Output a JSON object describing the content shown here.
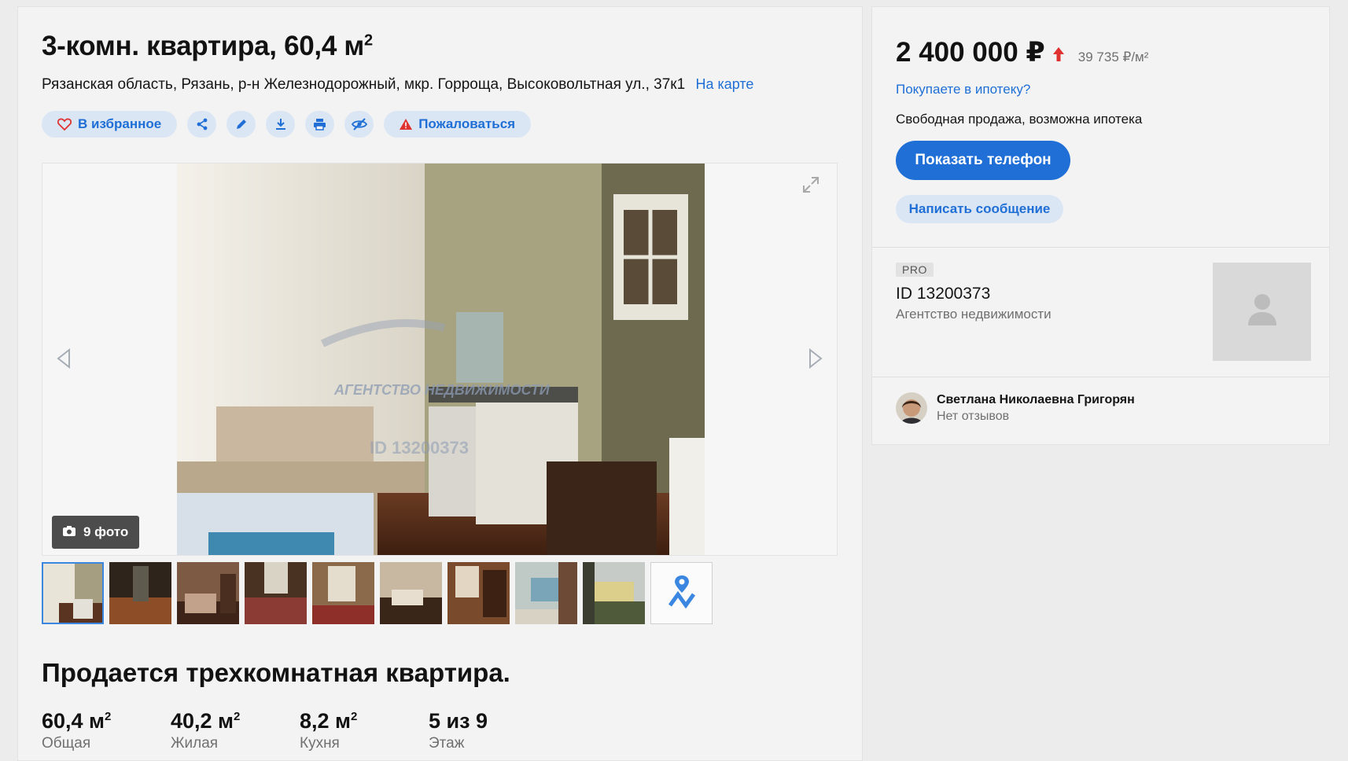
{
  "listing": {
    "title_text": "3-комн. квартира, 60,4 м",
    "title_sup": "2",
    "address": "Рязанская область, Рязань, р-н Железнодорожный, мкр. Горроща, Высоковольтная ул., 37к1",
    "map_link": "На карте"
  },
  "actions": {
    "favorite_label": "В избранное",
    "complain_label": "Пожаловаться",
    "icons": [
      "heart-icon",
      "share-icon",
      "pencil-icon",
      "download-icon",
      "print-icon",
      "hide-icon",
      "warning-icon"
    ]
  },
  "gallery": {
    "photo_count_label": "9 фото",
    "watermark_line1": "АГЕНТСТВО НЕДВИЖИМОСТИ",
    "watermark_line2": "ID 13200373",
    "thumbnails": 9
  },
  "description": {
    "heading": "Продается трехкомнатная квартира."
  },
  "facts": [
    {
      "value": "60,4 м",
      "sup": "2",
      "label": "Общая"
    },
    {
      "value": "40,2 м",
      "sup": "2",
      "label": "Жилая"
    },
    {
      "value": "8,2 м",
      "sup": "2",
      "label": "Кухня"
    },
    {
      "value": "5 из 9",
      "sup": "",
      "label": "Этаж"
    }
  ],
  "sidebar": {
    "price": "2 400 000 ₽",
    "price_per_m": "39 735 ₽/м²",
    "mortgage_link": "Покупаете в ипотеку?",
    "sale_type": "Свободная продажа, возможна ипотека",
    "phone_button": "Показать телефон",
    "message_button": "Написать сообщение",
    "pro_badge": "PRO",
    "agent_id": "ID 13200373",
    "agent_type": "Агентство недвижимости",
    "contact_name": "Светлана Николаевна Григорян",
    "contact_reviews": "Нет отзывов"
  },
  "colors": {
    "accent": "#1f6fd6",
    "pill_bg": "#dbe6f4",
    "price_up": "#e03131"
  }
}
